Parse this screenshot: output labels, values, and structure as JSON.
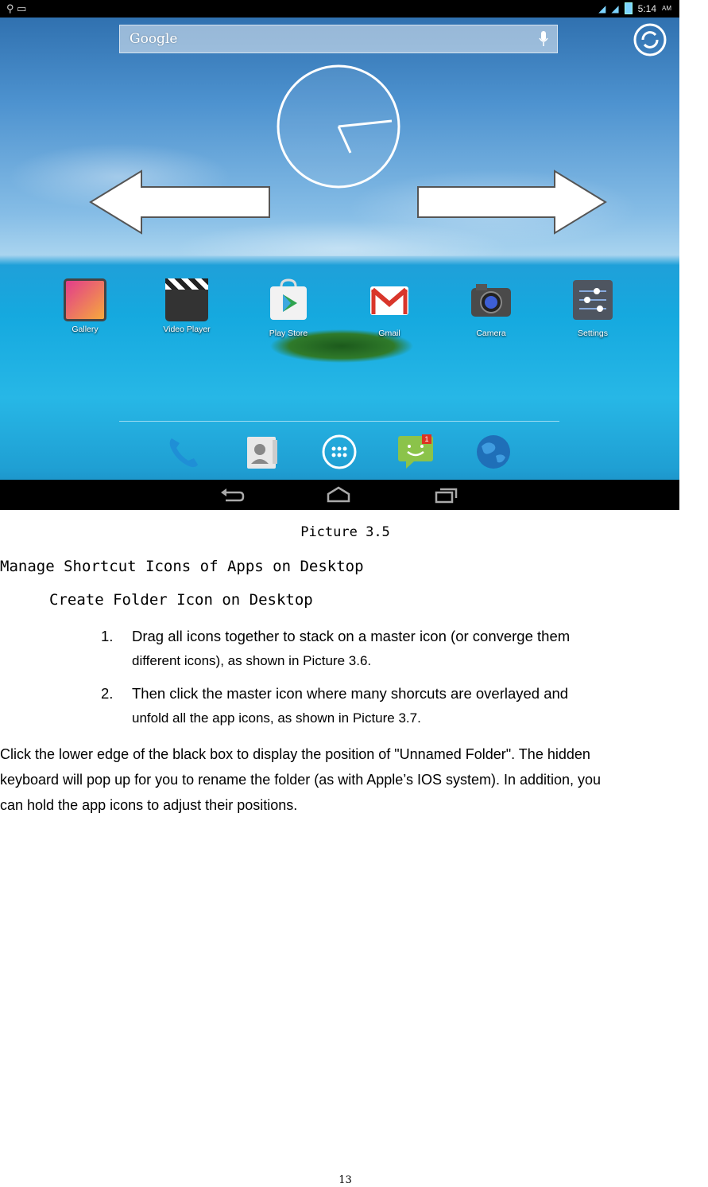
{
  "screenshot": {
    "status_time": "5:14",
    "status_ampm": "AM",
    "search_label": "Google",
    "apps": [
      {
        "label": "Gallery",
        "icon": "gallery-icon"
      },
      {
        "label": "Video Player",
        "icon": "clapperboard-icon"
      },
      {
        "label": "Play Store",
        "icon": "play-store-icon"
      },
      {
        "label": "Gmail",
        "icon": "gmail-icon"
      },
      {
        "label": "Camera",
        "icon": "camera-icon"
      },
      {
        "label": "Settings",
        "icon": "settings-sliders-icon"
      }
    ],
    "dock": [
      "phone-icon",
      "contacts-icon",
      "all-apps-icon",
      "messaging-icon",
      "browser-globe-icon"
    ],
    "message_badge": "1",
    "navbar": [
      "back-icon",
      "home-icon",
      "recent-apps-icon"
    ],
    "colors": {
      "sea": "#1fa9df",
      "sky": "#4d92cf",
      "bar": "#000000"
    }
  },
  "caption": "Picture 3.5",
  "heading1": "Manage Shortcut Icons of Apps on Desktop",
  "heading2": "Create Folder Icon on Desktop",
  "list": [
    {
      "num": "1.",
      "line1": "Drag all icons together to stack on a master icon  (or converge them",
      "line2": "different icons), as shown in Picture 3.6."
    },
    {
      "num": "2.",
      "line1": "Then click the master icon where many shorcuts are overlayed and",
      "line2": "unfold all the app icons, as shown in Picture 3.7."
    }
  ],
  "paragraph": [
    "Click the lower edge of the black box to display the position of \"Unnamed Folder\". The hidden",
    "keyboard will pop up for you to rename the folder (as with Apple’s IOS system). In addition, you",
    "can hold the app icons to adjust their positions."
  ],
  "page_number": "13"
}
